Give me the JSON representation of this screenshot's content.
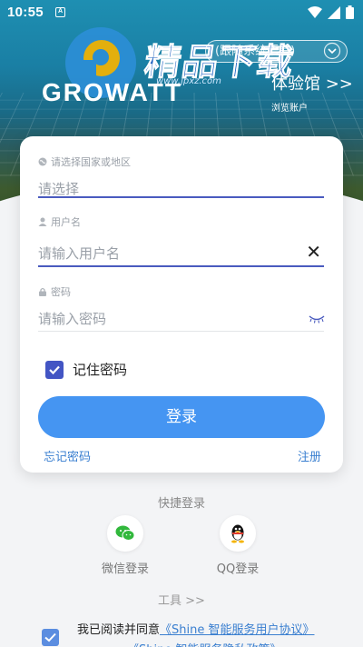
{
  "status_bar": {
    "time": "10:55",
    "notif_letter": "A"
  },
  "header": {
    "watermark_text": "精品下载",
    "watermark_url": "www.jpxz.com",
    "brand_name": "GROWATT",
    "language_label": "(跟随系统语言)",
    "experience_title": "体验馆 >>",
    "experience_sub": "浏览账户"
  },
  "form": {
    "region_label": "请选择国家或地区",
    "region_value": "请选择",
    "username_label": "用户名",
    "username_placeholder": "请输入用户名",
    "password_label": "密码",
    "password_placeholder": "请输入密码",
    "remember_label": "记住密码",
    "remember_checked": true,
    "login_label": "登录",
    "forgot_label": "忘记密码",
    "register_label": "注册"
  },
  "quick_login": {
    "title": "快捷登录",
    "wechat_label": "微信登录",
    "qq_label": "QQ登录"
  },
  "tools_label": "工具 >>",
  "agreement": {
    "prefix": "我已阅读并同意",
    "user_agreement": "《Shine 智能服务用户协议》",
    "privacy": "《Shine 智能服务隐私政策》"
  },
  "colors": {
    "accent": "#4595f2",
    "check": "#4355c4",
    "link": "#3a7fd0"
  }
}
